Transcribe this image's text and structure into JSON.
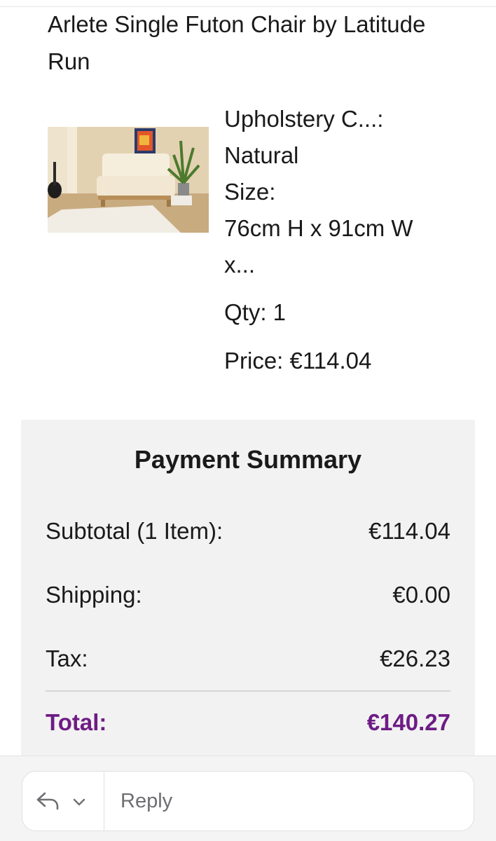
{
  "product": {
    "title": "Arlete Single Futon Chair by Latitude Run",
    "upholstery_label": "Upholstery C...:",
    "upholstery_value": "Natural",
    "size_label": "Size:",
    "size_value": "76cm H x 91cm W",
    "size_value_cont": "x...",
    "qty": "Qty: 1",
    "price": "Price: €114.04",
    "image_icon": "futon-chair-photo"
  },
  "summary": {
    "title": "Payment Summary",
    "subtotal_label": "Subtotal (1 Item):",
    "subtotal_value": "€114.04",
    "shipping_label": "Shipping:",
    "shipping_value": "€0.00",
    "tax_label": "Tax:",
    "tax_value": "€26.23",
    "total_label": "Total:",
    "total_value": "€140.27",
    "total_color": "#6e1c84"
  },
  "reply_bar": {
    "placeholder": "Reply",
    "reply_icon": "reply-arrow-icon",
    "chevron_icon": "chevron-down-icon"
  }
}
